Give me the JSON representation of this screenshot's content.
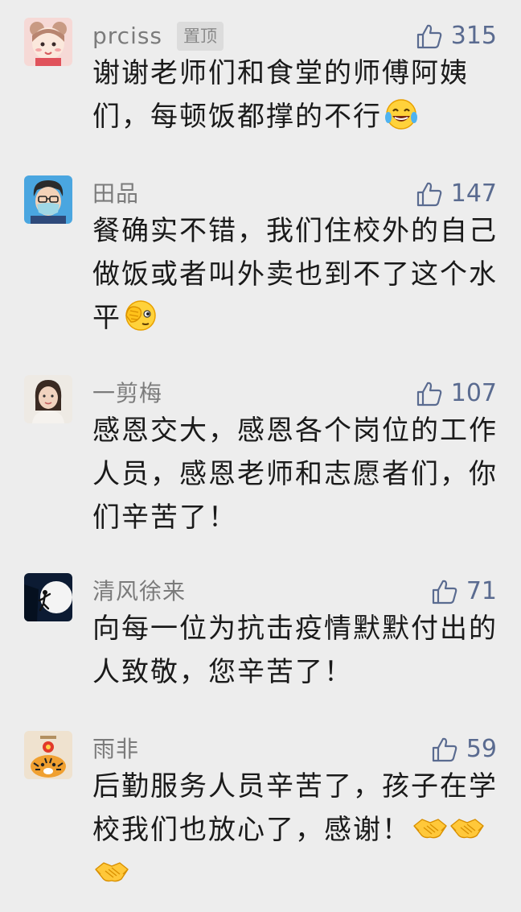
{
  "comments": [
    {
      "name": "prciss",
      "badge": "置顶",
      "likes": "315",
      "text": "谢谢老师们和食堂的师傅阿姨们，每顿饭都撑的不行",
      "emojis": [
        "laughing-tears-emoji"
      ]
    },
    {
      "name": "田品",
      "likes": "147",
      "text": "餐确实不错，我们住校外的自己做饭或者叫外卖也到不了这个水平",
      "emojis": [
        "facepalm-emoji"
      ]
    },
    {
      "name": "一剪梅",
      "likes": "107",
      "text": "感恩交大，感恩各个岗位的工作人员，感恩老师和志愿者们，你们辛苦了！",
      "emojis": []
    },
    {
      "name": "清风徐来",
      "likes": "71",
      "text": "向每一位为抗击疫情默默付出的人致敬，您辛苦了！",
      "emojis": []
    },
    {
      "name": "雨非",
      "likes": "59",
      "text": "后勤服务人员辛苦了，孩子在学校我们也放心了，感谢！",
      "emojis": [
        "handshake-emoji",
        "handshake-emoji",
        "handshake-emoji"
      ]
    }
  ],
  "colors": {
    "background": "#ededed",
    "name": "#7b7b7b",
    "like": "#5a6b90",
    "text": "#1a1a1a"
  },
  "icons": {
    "like": "thumbs-up-icon"
  }
}
